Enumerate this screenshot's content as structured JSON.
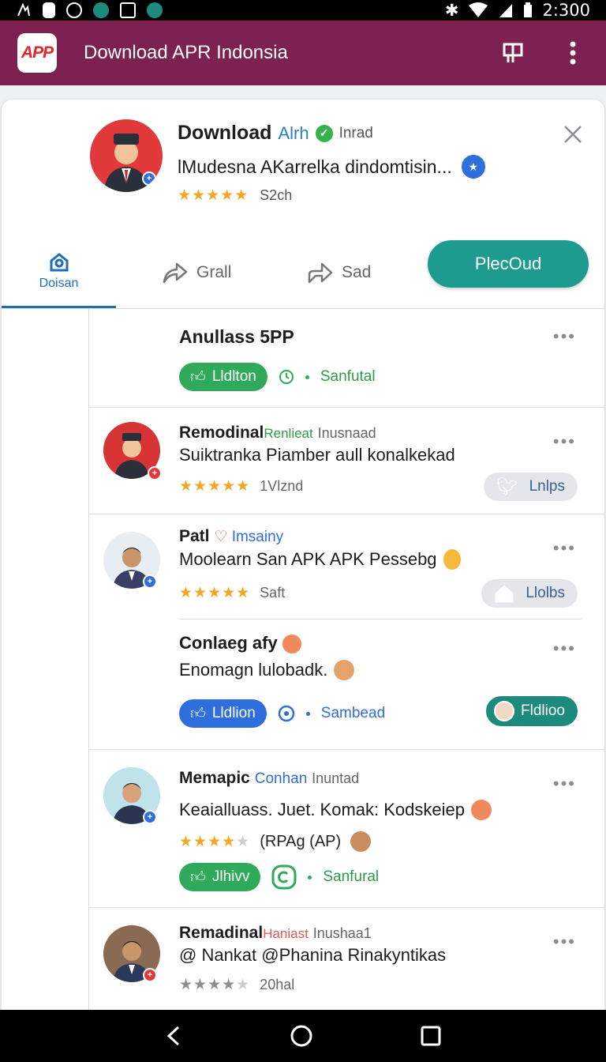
{
  "status_bar": {
    "time": "2:300"
  },
  "app_bar": {
    "logo_text": "APP",
    "title": "Download APR Indonsia"
  },
  "header": {
    "title": "Download",
    "title_accent": "Alrh",
    "title_muted": "Inrad",
    "subtitle": "lMudesna AKarrelka dindomtisin...",
    "rating_text": "S2ch",
    "rating": 5
  },
  "tabs": {
    "home_label": "Doisan",
    "grall_label": "Grall",
    "sad_label": "Sad",
    "primary_label": "PlecOud"
  },
  "posts": [
    {
      "name": "Anullass 5PP",
      "chip_label": "Lldlton",
      "meta_label": "Sanfutal"
    },
    {
      "name": "Remodinal",
      "tag": "Renlieat",
      "muted": "Inusnaad",
      "text": "Suiktranka Piamber aull konalkekad",
      "rating": 5,
      "rating_text": "1Vlznd",
      "pill_label": "Lnlps"
    },
    {
      "name": "Patl",
      "tag": "Imsainy",
      "text": "Moolearn San APK APK Pessebg",
      "rating": 5,
      "rating_text": "Saft",
      "pill_label": "Llolbs"
    },
    {
      "name": "Conlaeg afy",
      "text": "Enomagn lulobadk.",
      "chip_label": "Lldlion",
      "meta_label": "Sambead",
      "pill_label": "Fldlioo"
    },
    {
      "name": "Memapic",
      "tag": "Conhan",
      "muted": "Inuntad",
      "text": "Keaialluass. Juet. Komak: Kodskeiep",
      "rating": 4,
      "rating_text": "(RPAg (AP)",
      "chip_label": "Jlhivv",
      "meta_label": "Sanfural"
    },
    {
      "name": "Remadinal",
      "tag": "Haniast",
      "muted": "Inushaa1",
      "text": "@ Nankat @Phanina Rinakyntikas",
      "rating": 4,
      "rating_text": "20hal"
    }
  ],
  "colors": {
    "app_bar": "#7c2150",
    "primary_button": "#1d9b8f",
    "tab_active": "#1e6fb8",
    "star": "#f5a623",
    "chip_green": "#2faa5a",
    "chip_blue": "#2f6fdd"
  }
}
